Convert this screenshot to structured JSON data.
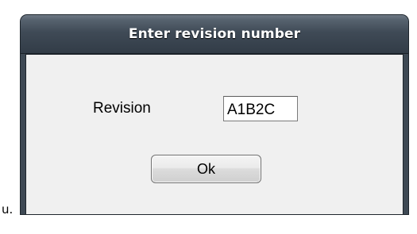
{
  "stray_text": "u.",
  "dialog": {
    "title": "Enter revision number",
    "revision_label": "Revision",
    "revision_value": "A1B2C",
    "ok_label": "Ok"
  },
  "colors": {
    "titlebar": "#3f4a56",
    "title_text": "#ffffff",
    "client_background": "#f0f0f0"
  }
}
